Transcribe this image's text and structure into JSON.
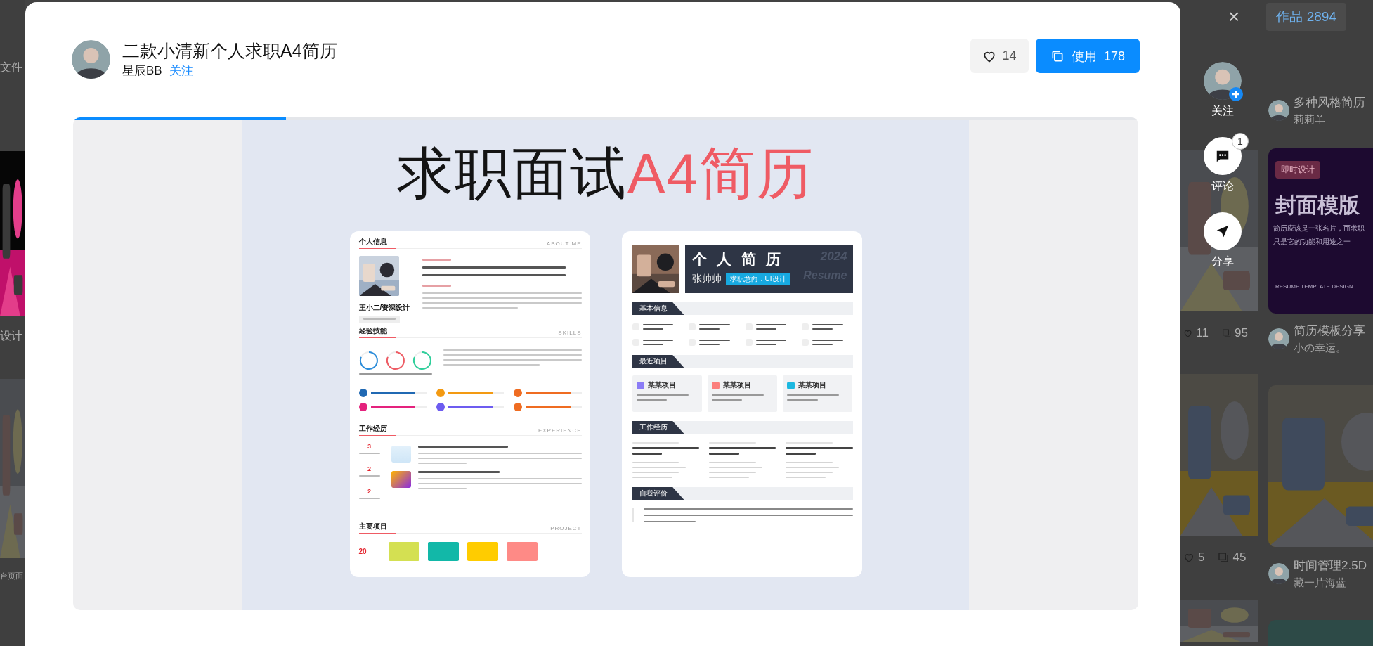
{
  "backdrop": {
    "top_bar": {
      "close": "×",
      "works_label": "作品",
      "works_count": "2894"
    },
    "filter_text": "文件",
    "left_labels": [
      "设计",
      "台页面"
    ],
    "stats": [
      {
        "likes": "11",
        "comments": "95"
      },
      {
        "likes": "5",
        "comments": "45"
      }
    ],
    "feed": [
      {
        "kind": "author",
        "title": "多种风格简历",
        "author": "莉莉羊"
      },
      {
        "kind": "cover",
        "tag": "即时设计",
        "heading": "封面模版",
        "lines": [
          "简历应该是一张名片，而求职",
          "只是它的功能和用途之一"
        ],
        "footer": "RESUME TEMPLATE DESIGN"
      },
      {
        "kind": "author",
        "title": "简历模板分享",
        "author": "小の幸运。"
      },
      {
        "kind": "picture"
      },
      {
        "kind": "author",
        "title": "时间管理2.5D",
        "author": "藏一片海蓝"
      },
      {
        "kind": "picture"
      }
    ]
  },
  "modal": {
    "title": "二款小清新个人求职A4简历",
    "author": "星辰BB",
    "follow": "关注",
    "likes": {
      "count": "14",
      "liked": false
    },
    "use": {
      "label": "使用",
      "count": "178"
    },
    "carousel": {
      "level": 0.2
    },
    "preview": {
      "headline": "求职面试",
      "headline_accent": "A4简历",
      "resume_a": {
        "sections": [
          {
            "title": "个人信息",
            "subtitle": "ABOUT ME"
          },
          {
            "title": "经验技能",
            "subtitle": "SKILLS"
          },
          {
            "title": "工作经历",
            "subtitle": "EXPERIENCE"
          },
          {
            "title": "主要项目",
            "subtitle": "PROJECT"
          }
        ],
        "name": "王小二/资深设计",
        "stats": [
          "3",
          "2",
          "2"
        ],
        "project_stat": "20",
        "projects": [
          {
            "color": "#d4e052"
          },
          {
            "color": "#12b8a8"
          },
          {
            "color": "#ffcc00"
          },
          {
            "color": "#fe8a86"
          }
        ]
      },
      "resume_b": {
        "title": "个人简历",
        "year": "2024",
        "name": "张帅帅",
        "intent": "求职意向：UI设计",
        "watermark": "Resume",
        "sections": [
          "基本信息",
          "最近项目",
          "工作经历",
          "自我评价"
        ],
        "projects": [
          {
            "title": "某某项目",
            "color": "#8b7cf6"
          },
          {
            "title": "某某项目",
            "color": "#fb7f7d"
          },
          {
            "title": "某某项目",
            "color": "#1cb8e0"
          }
        ]
      }
    }
  },
  "actions": [
    {
      "kind": "follow",
      "label": "关注"
    },
    {
      "kind": "comment",
      "label": "评论",
      "badge": "1"
    },
    {
      "kind": "share",
      "label": "分享"
    }
  ]
}
